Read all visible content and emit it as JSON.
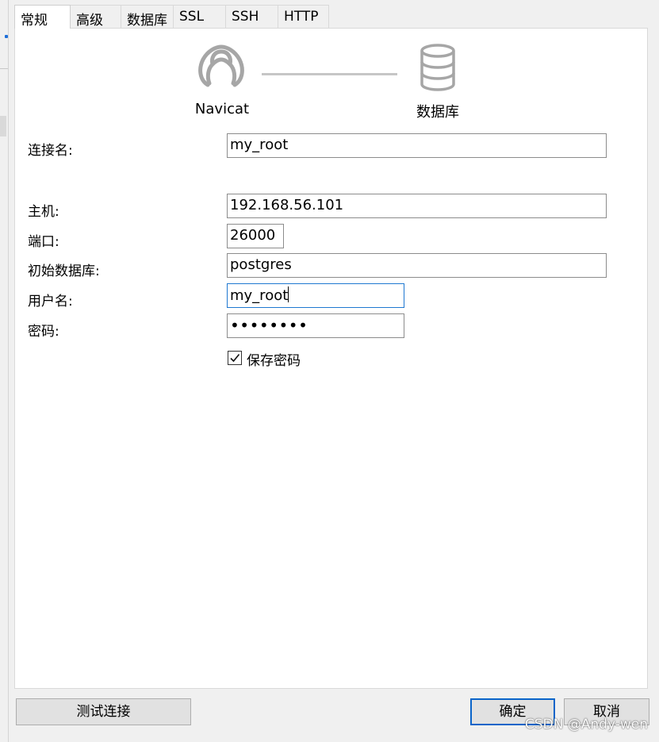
{
  "tabs": [
    {
      "label": "常规",
      "active": true
    },
    {
      "label": "高级",
      "active": false
    },
    {
      "label": "数据库",
      "active": false
    },
    {
      "label": "SSL",
      "active": false
    },
    {
      "label": "SSH",
      "active": false
    },
    {
      "label": "HTTP",
      "active": false
    }
  ],
  "diagram": {
    "left_label": "Navicat",
    "right_label": "数据库",
    "left_icon": "navicat-logo-icon",
    "right_icon": "database-icon",
    "icon_color": "#a6a6a6"
  },
  "form": {
    "connection_name": {
      "label": "连接名:",
      "value": "my_root"
    },
    "host": {
      "label": "主机:",
      "value": "192.168.56.101"
    },
    "port": {
      "label": "端口:",
      "value": "26000"
    },
    "initial_db": {
      "label": "初始数据库:",
      "value": "postgres"
    },
    "username": {
      "label": "用户名:",
      "value": "my_root"
    },
    "password": {
      "label": "密码:",
      "value": "••••••••"
    },
    "save_password": {
      "label": "保存密码",
      "checked": true
    }
  },
  "buttons": {
    "test": "测试连接",
    "ok": "确定",
    "cancel": "取消"
  },
  "watermark": "CSDN @Andy-wen",
  "colors": {
    "focus_border": "#1f78d1",
    "primary_border": "#0a64c9"
  }
}
